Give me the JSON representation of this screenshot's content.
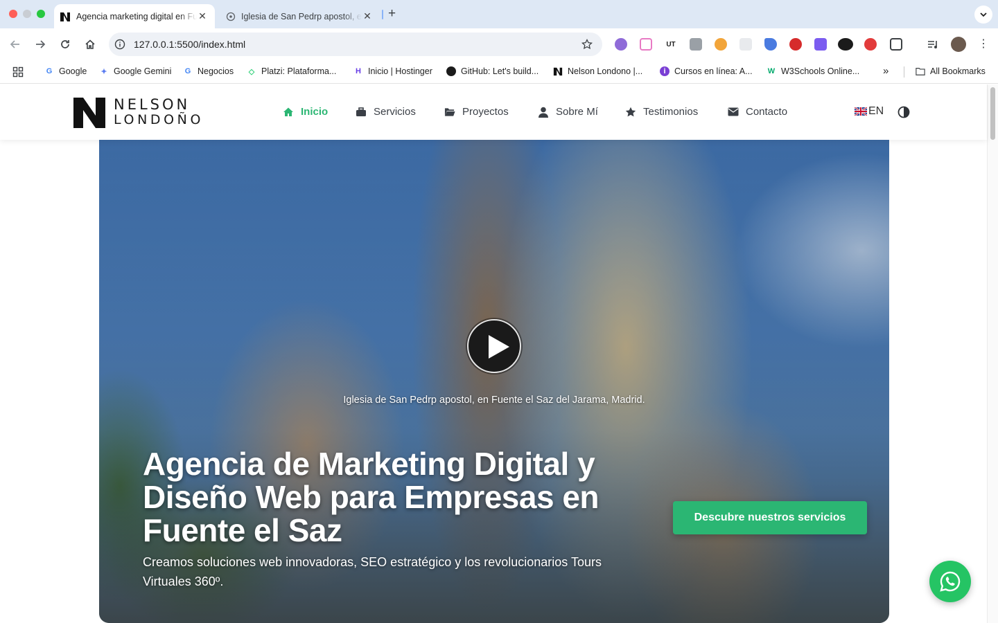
{
  "browser": {
    "tabs": [
      {
        "title": "Agencia marketing digital en Fuente el Saz",
        "active": true
      },
      {
        "title": "Iglesia de San Pedrp apostol, en Fuente el Saz del Jarama",
        "active": false
      }
    ],
    "new_tab_label": "+",
    "url": "127.0.0.1:5500/index.html",
    "bookmarks": [
      {
        "label": "Google",
        "icon": "google-icon"
      },
      {
        "label": "Google Gemini",
        "icon": "gemini-icon"
      },
      {
        "label": "Negocios",
        "icon": "google-icon"
      },
      {
        "label": "Platzi: Plataforma...",
        "icon": "platzi-icon"
      },
      {
        "label": "Inicio | Hostinger",
        "icon": "hostinger-icon"
      },
      {
        "label": "GitHub: Let's build...",
        "icon": "github-icon"
      },
      {
        "label": "Nelson Londono |...",
        "icon": "nelson-logo-icon"
      },
      {
        "label": "Cursos en línea: A...",
        "icon": "courses-icon"
      },
      {
        "label": "W3Schools Online...",
        "icon": "w3schools-icon"
      }
    ],
    "bookmarks_overflow": "»",
    "all_bookmarks": "All Bookmarks"
  },
  "site": {
    "logo": {
      "line1": "NELSON",
      "line2": "LONDOÑO"
    },
    "nav": [
      {
        "label": "Inicio",
        "icon": "home-icon",
        "active": true
      },
      {
        "label": "Servicios",
        "icon": "briefcase-icon",
        "active": false
      },
      {
        "label": "Proyectos",
        "icon": "folder-icon",
        "active": false
      },
      {
        "label": "Sobre Mí",
        "icon": "user-icon",
        "active": false
      },
      {
        "label": "Testimonios",
        "icon": "star-icon",
        "active": false
      },
      {
        "label": "Contacto",
        "icon": "envelope-icon",
        "active": false
      }
    ],
    "language": "EN",
    "accent_color": "#2bb673"
  },
  "hero": {
    "video_caption": "Iglesia de San Pedrp apostol, en Fuente el Saz del Jarama, Madrid.",
    "title": "Agencia de Marketing Digital y Diseño Web para Empresas en Fuente el Saz",
    "subtitle": "Creamos soluciones web innovadoras, SEO estratégico y los revolucionarios Tours Virtuales 360º.",
    "cta_label": "Descubre nuestros servicios"
  }
}
